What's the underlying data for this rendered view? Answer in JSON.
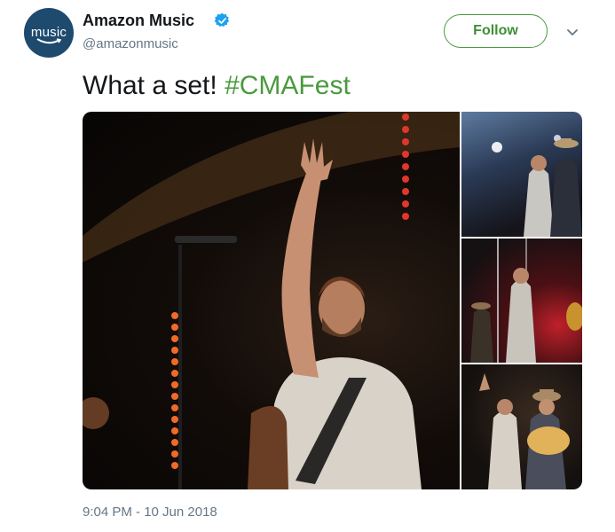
{
  "account": {
    "avatar_text": "music",
    "name": "Amazon Music",
    "handle": "@amazonmusic",
    "verified_icon": "verified-badge-icon"
  },
  "actions": {
    "follow_label": "Follow",
    "menu_icon": "chevron-down-icon"
  },
  "tweet": {
    "text": "What a set! ",
    "hashtag": "#CMAFest",
    "timestamp": "9:04 PM - 10 Jun 2018"
  },
  "colors": {
    "accent": "#4a9a3e",
    "verified": "#1da1f2",
    "muted": "#657786",
    "avatar_bg": "#1e4a6e"
  },
  "media": {
    "photos": [
      "photo-main",
      "photo-thumb-1",
      "photo-thumb-2",
      "photo-thumb-3"
    ]
  }
}
